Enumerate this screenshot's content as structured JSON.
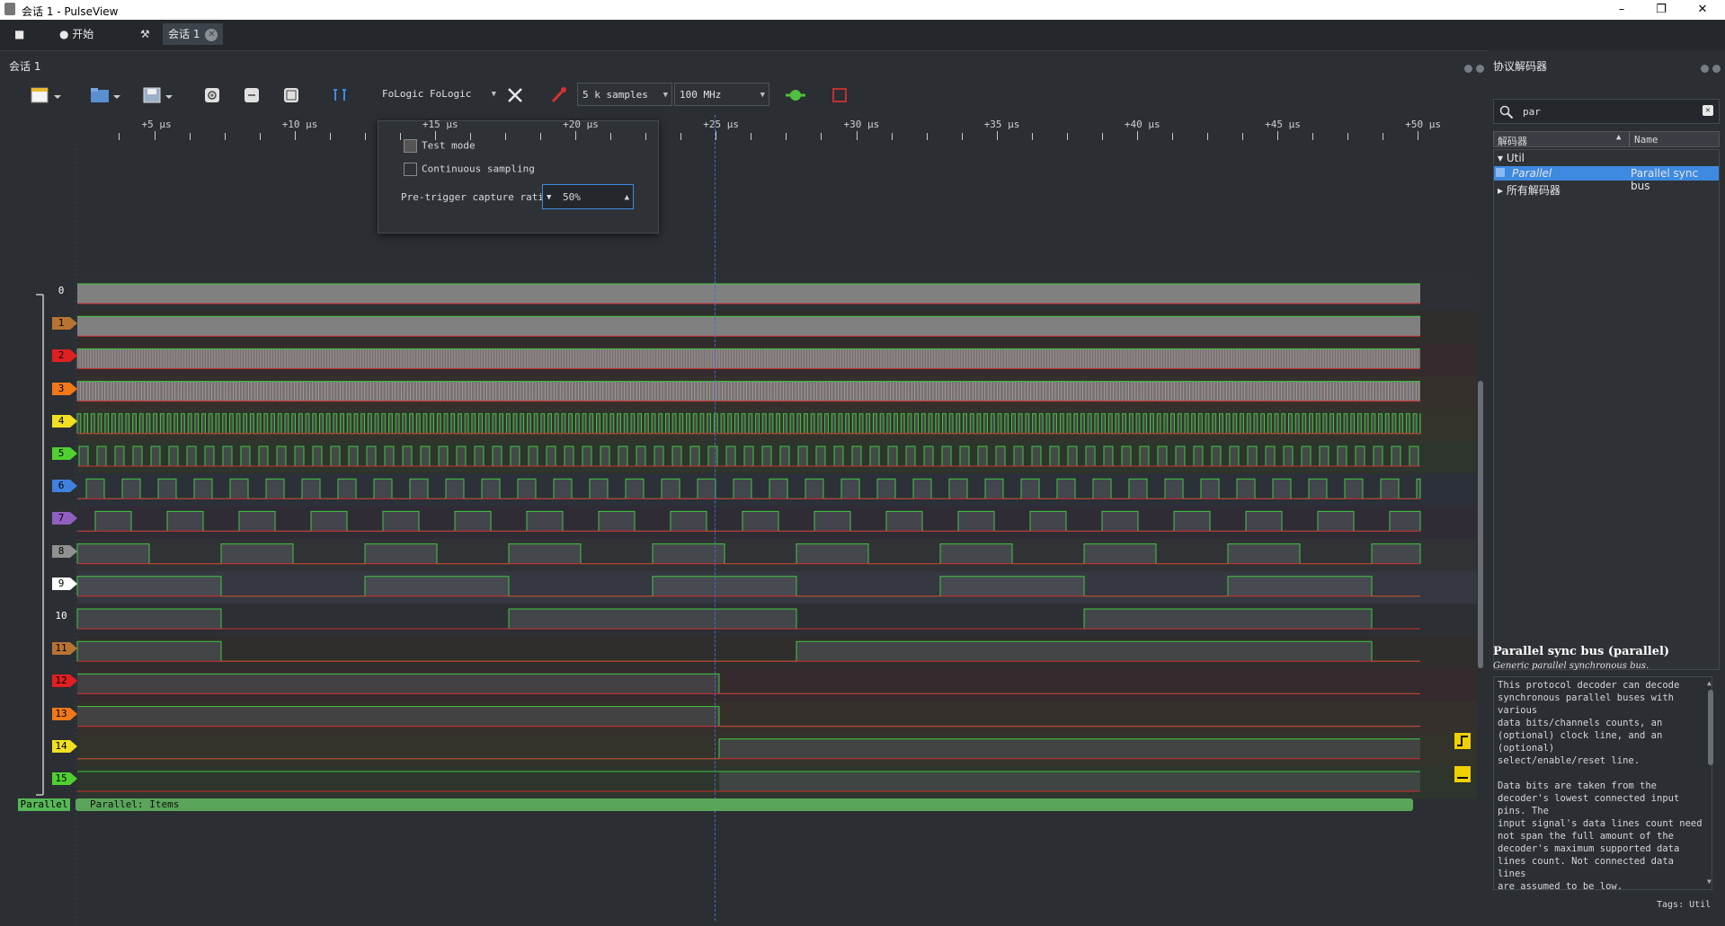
{
  "window": {
    "title": "会话 1 - PulseView",
    "minimize": "–",
    "restore": "❐",
    "close": "✕"
  },
  "tabs": {
    "stop_icon": "■",
    "start_label": "开始",
    "settings_glyph": "⚒",
    "session_label": "会话 1",
    "close_glyph": "✕"
  },
  "session_panel": {
    "title": "会话 1"
  },
  "toolbar": {
    "device": "FoLogic FoLogic",
    "samples": "5 k samples",
    "samplerate": "100 MHz",
    "icons": [
      "new-session-icon",
      "open-file-icon",
      "save-icon",
      "zoom-in-icon",
      "zoom-out-icon",
      "zoom-fit-icon",
      "cursor-icon",
      "config-wrench-icon",
      "probes-icon",
      "run-icon",
      "stop-square-icon"
    ]
  },
  "config_popup": {
    "test_mode_label": "Test mode",
    "continuous_label": "Continuous sampling",
    "pretrigger_label": "Pre-trigger capture ratio",
    "pretrigger_value": "50%"
  },
  "ruler": {
    "labels": [
      "+5 µs",
      "+10 µs",
      "+15 µs",
      "+20 µs",
      "+25 µs",
      "+30 µs",
      "+35 µs",
      "+40 µs",
      "+45 µs",
      "+50 µs"
    ]
  },
  "channels": [
    {
      "label": "0",
      "color": "#c8c8c8",
      "tint": "#2c2f34"
    },
    {
      "label": "1",
      "color": "#b87333",
      "tint": "#2f2e2c"
    },
    {
      "label": "2",
      "color": "#e02020",
      "tint": "#352a2d"
    },
    {
      "label": "3",
      "color": "#f07818",
      "tint": "#35302c"
    },
    {
      "label": "4",
      "color": "#f0e020",
      "tint": "#33332c"
    },
    {
      "label": "5",
      "color": "#50d030",
      "tint": "#2d352c"
    },
    {
      "label": "6",
      "color": "#4080e0",
      "tint": "#2c3038"
    },
    {
      "label": "7",
      "color": "#9060c0",
      "tint": "#2f2c36"
    },
    {
      "label": "8",
      "color": "#909090",
      "tint": "#303236"
    },
    {
      "label": "9",
      "color": "#ffffff",
      "tint": "#353840"
    },
    {
      "label": "10",
      "color": "#2b2e33",
      "tint": "#2c2f34"
    },
    {
      "label": "11",
      "color": "#b87333",
      "tint": "#2f2e2c"
    },
    {
      "label": "12",
      "color": "#e02020",
      "tint": "#352a2d"
    },
    {
      "label": "13",
      "color": "#f07818",
      "tint": "#35302c"
    },
    {
      "label": "14",
      "color": "#f0e020",
      "tint": "#33332c"
    },
    {
      "label": "15",
      "color": "#50d030",
      "tint": "#2d352c"
    }
  ],
  "decoder_row": {
    "badge": "Parallel",
    "annotation_label": "Parallel: Items"
  },
  "decoder_panel": {
    "title": "协议解码器",
    "search_value": "par",
    "col_decoder": "解码器",
    "col_name": "Name",
    "tree": {
      "group": "Util",
      "item_id": "Parallel",
      "item_name": "Parallel sync bus",
      "all_label": "所有解码器"
    },
    "info_title": "Parallel sync bus (parallel)",
    "info_subtitle": "Generic parallel synchronous bus.",
    "description_lines": [
      "This protocol decoder can decode",
      "synchronous parallel buses with",
      "various",
      "data bits/channels counts, an",
      "(optional) clock line, and an",
      "(optional)",
      "select/enable/reset line.",
      "",
      "Data bits are taken from the",
      "decoder's lowest connected input",
      "pins. The",
      "input signal's data lines count need",
      "not span the full amount of the",
      "decoder's maximum supported data",
      "lines count. Not connected data",
      "lines",
      "are assumed to be low."
    ],
    "tags": "Tags: Util"
  }
}
